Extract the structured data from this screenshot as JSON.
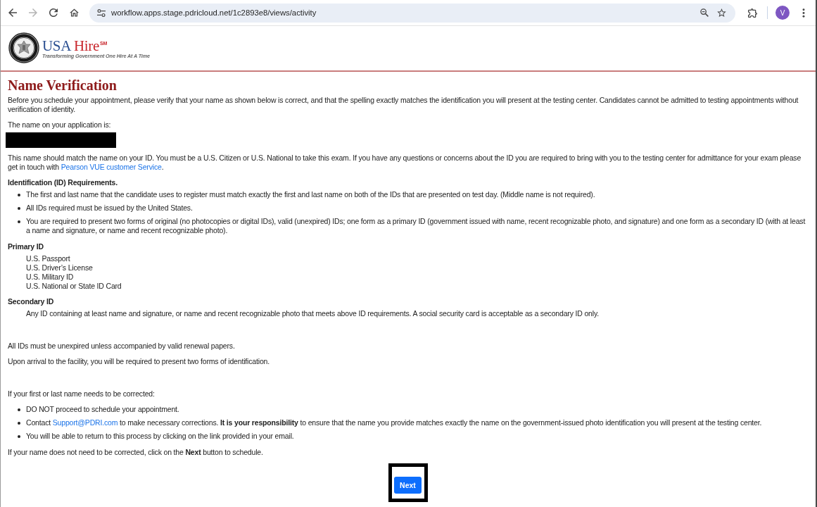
{
  "browser": {
    "back_button": {
      "disabled": false
    },
    "forward_button": {
      "disabled": true
    },
    "url": "workflow.apps.stage.pdricloud.net/1c2893e8/views/activity",
    "profile_initial": "V"
  },
  "header": {
    "logo_word_1": "USA",
    "logo_word_2": "Hire",
    "logo_mark": "SM",
    "tagline": "Transforming Government One Hire At A Time"
  },
  "page_title": "Name Verification",
  "sections": [
    {
      "blocks": [
        {
          "kind": "paragraph",
          "parts": [
            {
              "kind": "text",
              "text": "Before you schedule your appointment, please verify that your name as shown below is correct, and that the spelling exactly matches the identification you will present at the testing center. Candidates cannot be admitted to testing appointments without verification of identity."
            }
          ]
        },
        {
          "kind": "paragraph",
          "parts": [
            {
              "kind": "text",
              "text": "The name on your application is:"
            }
          ]
        },
        {
          "kind": "redaction"
        },
        {
          "kind": "paragraph",
          "parts": [
            {
              "kind": "text",
              "text": "This name should match the name on your ID. You must be a U.S. Citizen or U.S. National to take this exam. If you have any questions or concerns about the ID you are required to bring with you to the testing center for admittance for your exam please get in touch with "
            },
            {
              "kind": "link",
              "text": "Pearson VUE customer Service"
            },
            {
              "kind": "text",
              "text": "."
            }
          ]
        },
        {
          "kind": "heading",
          "text": "Identification (ID) Requirements."
        },
        {
          "kind": "bullets",
          "items": [
            {
              "parts": [
                {
                  "kind": "text",
                  "text": "The first and last name that the candidate uses to register must match exactly the first and last name on both of the IDs that are presented on test day. (Middle name is not required)."
                }
              ]
            },
            {
              "parts": [
                {
                  "kind": "text",
                  "text": "All IDs required must be issued by the United States."
                }
              ]
            },
            {
              "parts": [
                {
                  "kind": "text",
                  "text": "You are required to present two forms of original (no photocopies or digital IDs), valid (unexpired) IDs; one form as a primary ID (government issued with name, recent recognizable photo, and signature) and one form as a secondary ID (with at least a name and signature, or name and recent recognizable photo)."
                }
              ]
            }
          ]
        },
        {
          "kind": "heading",
          "text": "Primary ID"
        },
        {
          "kind": "lines",
          "items": [
            "U.S. Passport",
            "U.S. Driver’s License",
            "U.S. Military ID",
            "U.S. National or State ID Card"
          ]
        },
        {
          "kind": "heading",
          "text": "Secondary ID"
        },
        {
          "kind": "lines",
          "items": [
            "Any ID containing at least name and signature, or name and recent recognizable photo that meets above ID requirements. A social security card is acceptable as a secondary ID only."
          ]
        }
      ]
    },
    {
      "blocks": [
        {
          "kind": "paragraph",
          "parts": [
            {
              "kind": "text",
              "text": "All IDs must be unexpired unless accompanied by valid renewal papers."
            }
          ]
        },
        {
          "kind": "paragraph",
          "parts": [
            {
              "kind": "text",
              "text": "Upon arrival to the facility, you will be required to present two forms of identification."
            }
          ]
        }
      ]
    },
    {
      "blocks": [
        {
          "kind": "paragraph",
          "parts": [
            {
              "kind": "text",
              "text": "If your first or last name needs to be corrected:"
            }
          ]
        },
        {
          "kind": "bullets",
          "items": [
            {
              "parts": [
                {
                  "kind": "text",
                  "text": "DO NOT proceed to schedule your appointment."
                }
              ]
            },
            {
              "parts": [
                {
                  "kind": "text",
                  "text": "Contact "
                },
                {
                  "kind": "link",
                  "text": "Support@PDRI.com"
                },
                {
                  "kind": "text",
                  "text": " to make necessary corrections. **It is your responsibility** to ensure that the name you provide matches exactly the name on the government-issued photo identification you will present at the testing center."
                }
              ]
            },
            {
              "parts": [
                {
                  "kind": "text",
                  "text": "You will be able to return to this process by clicking on the link provided in your email."
                }
              ]
            }
          ]
        },
        {
          "kind": "paragraph",
          "parts": [
            {
              "kind": "text",
              "text": "If your name does not need to be corrected, click on the **Next** button to schedule."
            }
          ]
        }
      ]
    }
  ],
  "next_button": "Next"
}
